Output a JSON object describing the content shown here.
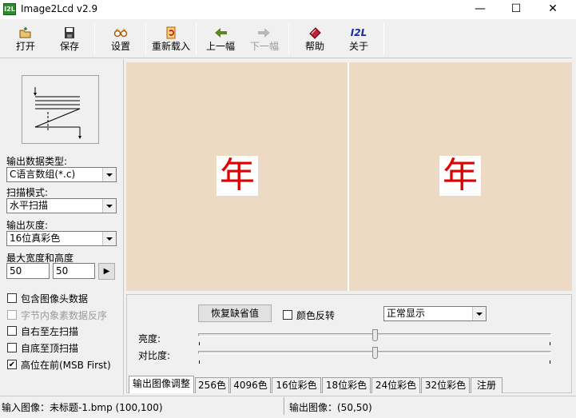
{
  "window": {
    "title": "Image2Lcd v2.9",
    "icon_text": "I2L",
    "minimize": "—",
    "maximize": "☐",
    "close": "✕"
  },
  "toolbar": {
    "open": "打开",
    "save": "保存",
    "settings": "设置",
    "reload": "重新载入",
    "prev": "上一幅",
    "next": "下一幅",
    "help": "帮助",
    "about": "关于",
    "about_icon_text": "I2L"
  },
  "left": {
    "output_type_label": "输出数据类型:",
    "output_type_value": "C语言数组(*.c)",
    "scan_mode_label": "扫描模式:",
    "scan_mode_value": "水平扫描",
    "gray_label": "输出灰度:",
    "gray_value": "16位真彩色",
    "max_size_label": "最大宽度和高度",
    "max_width": "50",
    "max_height": "50",
    "options": [
      {
        "label": "包含图像头数据",
        "checked": false,
        "enabled": true
      },
      {
        "label": "字节内象素数据反序",
        "checked": false,
        "enabled": false
      },
      {
        "label": "自右至左扫描",
        "checked": false,
        "enabled": true
      },
      {
        "label": "自底至顶扫描",
        "checked": false,
        "enabled": true
      },
      {
        "label": "高位在前(MSB First)",
        "checked": true,
        "enabled": true
      }
    ]
  },
  "preview": {
    "left_char": "年",
    "right_char": "年",
    "char_color": "#e00000",
    "bg_color": "#eddac4"
  },
  "adjust": {
    "restore_button": "恢复缺省值",
    "invert_label": "颜色反转",
    "display_mode": "正常显示",
    "brightness_label": "亮度:",
    "contrast_label": "对比度:",
    "brightness_level": 0.5,
    "contrast_level": 0.5
  },
  "tabs": [
    "输出图像调整",
    "256色",
    "4096色",
    "16位彩色",
    "18位彩色",
    "24位彩色",
    "32位彩色",
    "注册"
  ],
  "status": {
    "input": "输入图像：未标题-1.bmp (100,100)",
    "output": "输出图像：(50,50)"
  }
}
